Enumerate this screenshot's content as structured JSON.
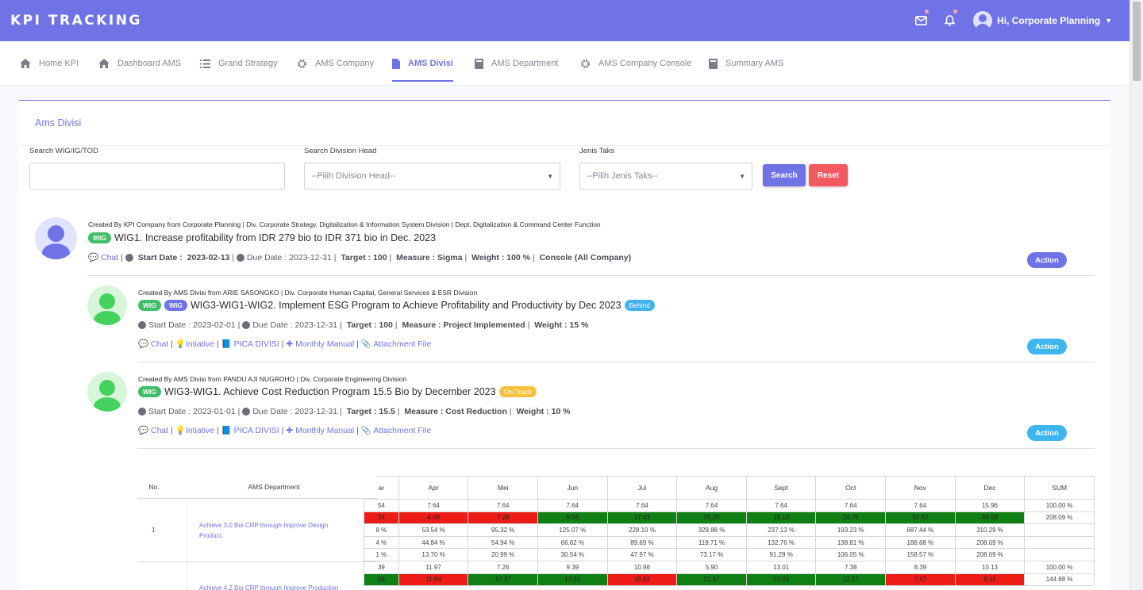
{
  "app": {
    "brand": "KPI TRACKING",
    "user_greeting": "Hi, Corporate Planning"
  },
  "nav": [
    {
      "label": "Home KPI",
      "icon": "home-icon"
    },
    {
      "label": "Dashboard AMS",
      "icon": "home-icon"
    },
    {
      "label": "Grand Strategy",
      "icon": "list-icon"
    },
    {
      "label": "AMS Company",
      "icon": "gear-icon"
    },
    {
      "label": "AMS Divisi",
      "icon": "file-icon",
      "active": true
    },
    {
      "label": "AMS Department",
      "icon": "book-icon"
    },
    {
      "label": "AMS Company Console",
      "icon": "gear-icon"
    },
    {
      "label": "Summary AMS",
      "icon": "book-icon"
    }
  ],
  "page": {
    "title": "Ams Divisi"
  },
  "filters": {
    "wig_label": "Search WIG/IG/TOD",
    "wig_value": "",
    "head_label": "Search Division Head",
    "head_value": "--Pilih Division Head--",
    "taks_label": "Jenis Taks",
    "taks_value": "--Pilih Jenis Taks--",
    "search_btn": "Search",
    "reset_btn": "Reset"
  },
  "entries": [
    {
      "created": "Created By KPI Company from Corporate Planning | Div. Corporate Strategy, Digitalization & Information System Division | Dept. Digitalization & Command Center Function",
      "badges": [
        "WIG"
      ],
      "title": "WIG1. Increase profitability from IDR 279 bio to IDR 371 bio in Dec. 2023",
      "status": "",
      "chat": "Chat",
      "start_label": "Start Date :",
      "start": "2023-02-13",
      "due_label": "Due Date :",
      "due": "2023-12-31",
      "target": "Target : 100",
      "measure": "Measure : Sigma",
      "weight": "Weight : 100 %",
      "console": "Console (All Company)",
      "action": "Action"
    },
    {
      "created": "Created By AMS Divisi from ARIE SASONGKO | Div. Corporate Human Capital, General Services & ESR Division",
      "badges": [
        "WIG",
        "WIG"
      ],
      "title": "WIG3-WIG1-WIG2. Implement ESG Program to Achieve Profitability and Productivity by Dec 2023",
      "status": "Behind",
      "start_label": "Start Date :",
      "start": "2023-02-01",
      "due_label": "Due Date :",
      "due": "2023-12-31",
      "target": "Target : 100",
      "measure": "Measure : Project Implemented",
      "weight": "Weight : 15 %",
      "links": [
        "Chat",
        "Intiative",
        "PICA DIVISI",
        "Monthly Manual",
        "Attachment File"
      ],
      "action": "Action"
    },
    {
      "created": "Created By AMS Divisi from PANDU AJI NUGROHO | Div. Corporate Engineering Division",
      "badges": [
        "WIG"
      ],
      "title": "WIG3-WIG1. Achieve Cost Reduction Program 15.5 Bio by December 2023",
      "status": "On-Track",
      "start_label": "Start Date :",
      "start": "2023-01-01",
      "due_label": "Due Date :",
      "due": "2023-12-31",
      "target": "Target : 15.5",
      "measure": "Measure : Cost Reduction",
      "weight": "Weight : 10 %",
      "links": [
        "Chat",
        "Intiative",
        "PICA DIVISI",
        "Monthly Manual",
        "Attachment File"
      ],
      "action": "Action"
    }
  ],
  "table": {
    "headers": [
      "No.",
      "AMS Department",
      "ar",
      "Apr",
      "Mei",
      "Jun",
      "Jul",
      "Aug",
      "Sept",
      "Oct",
      "Nov",
      "Dec",
      "SUM"
    ],
    "rows": [
      {
        "no": "1",
        "dept": "Achieve 3,0 Bio CRP through Improve Design Product.",
        "lines": [
          {
            "cells": [
              "54",
              "7.64",
              "7.64",
              "7.64",
              "7.64",
              "7.64",
              "7.64",
              "7.64",
              "7.64",
              "15.96",
              "100.00 %"
            ],
            "colors": [
              "",
              "",
              "",
              "",
              "",
              "",
              "",
              "",
              "",
              "",
              ""
            ]
          },
          {
            "cells": [
              "24",
              "4.09",
              "7.28",
              "9.56",
              "17.43",
              "25.20",
              "18.12",
              "14.76",
              "52.52",
              "49.53",
              "208.09 %"
            ],
            "colors": [
              "r",
              "r",
              "r",
              "g",
              "g",
              "g",
              "g",
              "g",
              "g",
              "g",
              ""
            ]
          },
          {
            "cells": [
              "8 %",
              "53.54 %",
              "95.32 %",
              "125.07 %",
              "228.10 %",
              "329.88 %",
              "237.13 %",
              "193.23 %",
              "687.44 %",
              "310.29 %",
              ""
            ],
            "colors": [
              "",
              "",
              "",
              "",
              "",
              "",
              "",
              "",
              "",
              "",
              ""
            ]
          },
          {
            "cells": [
              "4 %",
              "44.84 %",
              "54.94 %",
              "66.62 %",
              "89.69 %",
              "119.71 %",
              "132.76 %",
              "138.81 %",
              "188.68 %",
              "208.09 %",
              ""
            ],
            "colors": [
              "",
              "",
              "",
              "",
              "",
              "",
              "",
              "",
              "",
              "",
              ""
            ]
          },
          {
            "cells": [
              "1 %",
              "13.70 %",
              "20.99 %",
              "30.54 %",
              "47.97 %",
              "73.17 %",
              "91.29 %",
              "106.05 %",
              "158.57 %",
              "208.09 %",
              ""
            ],
            "colors": [
              "",
              "",
              "",
              "",
              "",
              "",
              "",
              "",
              "",
              "",
              ""
            ]
          }
        ]
      },
      {
        "no": "2",
        "dept": "Achieve 4,2 Bio CRP through Improve Production",
        "lines": [
          {
            "cells": [
              "39",
              "11.97",
              "7.26",
              "9.39",
              "10.96",
              "5.90",
              "13.01",
              "7.38",
              "8.39",
              "10.13",
              "100.00 %"
            ],
            "colors": [
              "",
              "",
              "",
              "",
              "",
              "",
              "",
              "",
              "",
              "",
              ""
            ]
          },
          {
            "cells": [
              "06",
              "11.94",
              "17.37",
              "13.93",
              "10.83",
              "21.97",
              "22.04",
              "12.27",
              "7.47",
              "9.11",
              "144.68 %"
            ],
            "colors": [
              "g",
              "r",
              "g",
              "g",
              "r",
              "g",
              "g",
              "g",
              "r",
              "r",
              ""
            ]
          }
        ]
      }
    ]
  }
}
